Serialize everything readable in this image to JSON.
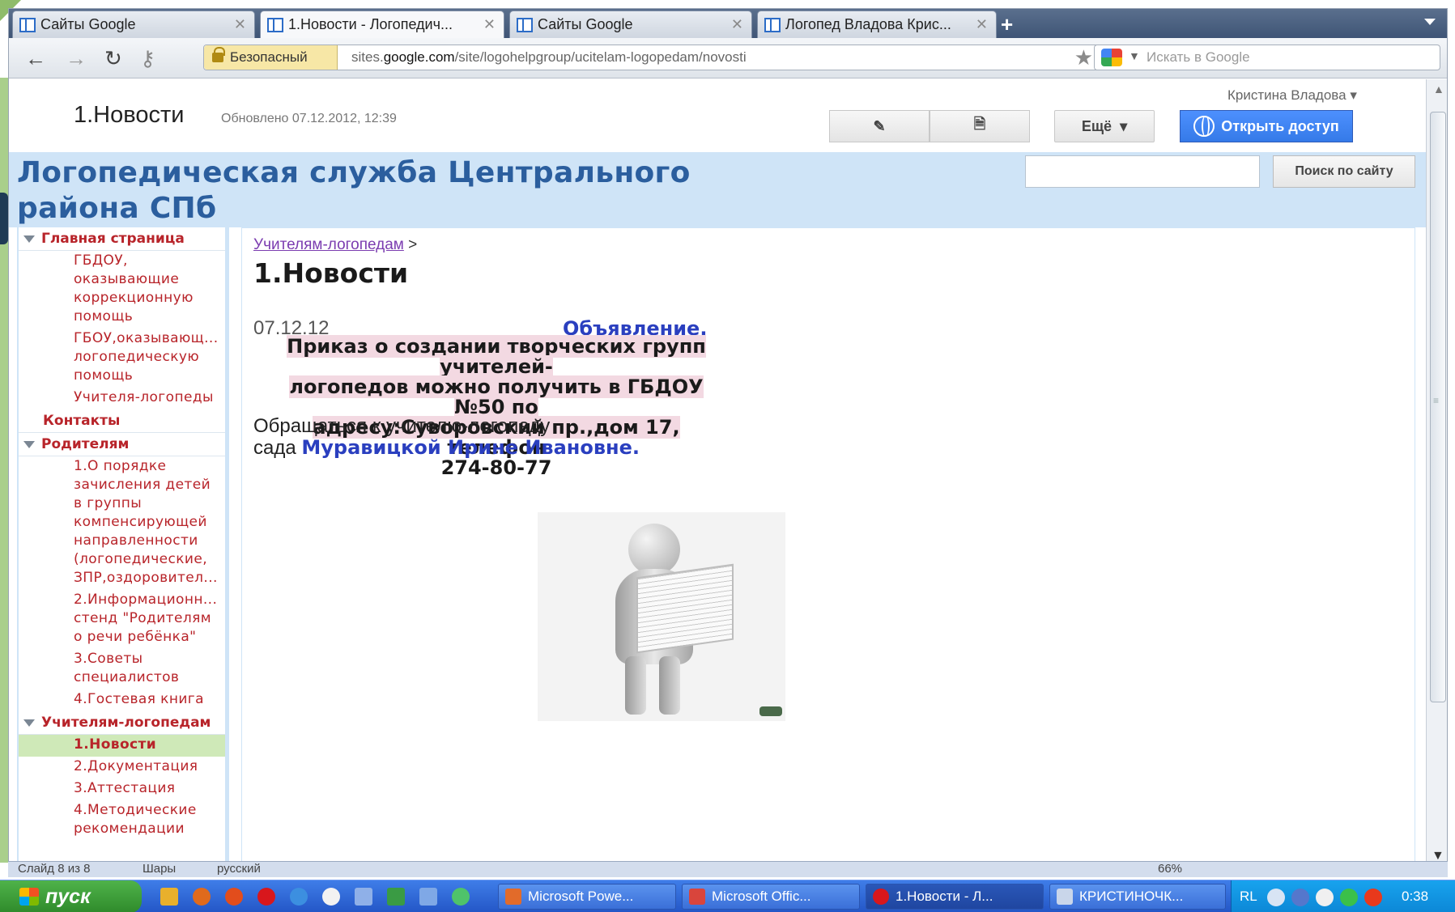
{
  "browser": {
    "tabs": [
      {
        "label": "Сайты Google",
        "active": false
      },
      {
        "label": "1.Новости - Логопедич...",
        "active": true
      },
      {
        "label": "Сайты Google",
        "active": false
      },
      {
        "label": "Логопед Владова Крис...",
        "active": false
      }
    ],
    "security_label": "Безопасный",
    "url_prefix": "sites.",
    "url_domain": "google.com",
    "url_path": "/site/logohelpgroup/ucitelam-logopedam/novosti",
    "search_placeholder": "Искать в Google"
  },
  "site": {
    "user_menu": "Кристина Владова",
    "page_title": "1.Новости",
    "updated": "Обновлено 07.12.2012, 12:39",
    "more_label": "Ещё",
    "share_label": "Открыть доступ",
    "site_title": "Логопедическая служба Центрального района СПб",
    "search_button": "Поиск по сайту"
  },
  "sidebar": {
    "sections": [
      {
        "label": "Главная страница",
        "items": [
          "ГБДОУ, оказывающие коррекционную помощь",
          "ГБОУ,оказывающ... логопедическую помощь",
          "Учителя-логопеды"
        ]
      },
      {
        "label": "Контакты",
        "items": []
      },
      {
        "label": "Родителям",
        "items": [
          "1.О порядке зачисления детей в группы компенсирующей направленности (логопедические, ЗПР,оздоровител...",
          "2.Информационн... стенд \"Родителям о речи ребёнка\"",
          "3.Советы специалистов",
          "4.Гостевая книга"
        ]
      },
      {
        "label": "Учителям-логопедам",
        "items": [
          "1.Новости",
          "2.Документация",
          "3.Аттестация",
          "4.Методические рекомендации"
        ]
      }
    ]
  },
  "content": {
    "breadcrumb_link": "Учителям-логопедам",
    "breadcrumb_sep": ">",
    "title": "1.Новости",
    "post_date": "07.12.12",
    "announcement": "Объявление.",
    "order_line1": "Приказ о создании творческих групп учителей-",
    "order_line2": "логопедов можно получить   в ГБДОУ №50 по",
    "order_line3_a": "адресу:Суворовский пр.,дом 17,",
    "order_line3_b": " телефон",
    "order_line4": "274-80-77",
    "contact_line1": "Обращаться к учителю-логопеду",
    "contact_line2": "сада ",
    "contact_name": "Муравицкой Ирине Ивановне."
  },
  "ppt_status": {
    "slide": "Слайд 8 из 8",
    "theme": "Шары",
    "lang": "русский",
    "zoom": "66%"
  },
  "taskbar": {
    "start_label": "пуск",
    "tasks": [
      "Microsoft Powe...",
      "Microsoft Offic...",
      "1.Новости - Л...",
      "КРИСТИНОЧК..."
    ],
    "lang": "RL",
    "clock": "0:38"
  }
}
